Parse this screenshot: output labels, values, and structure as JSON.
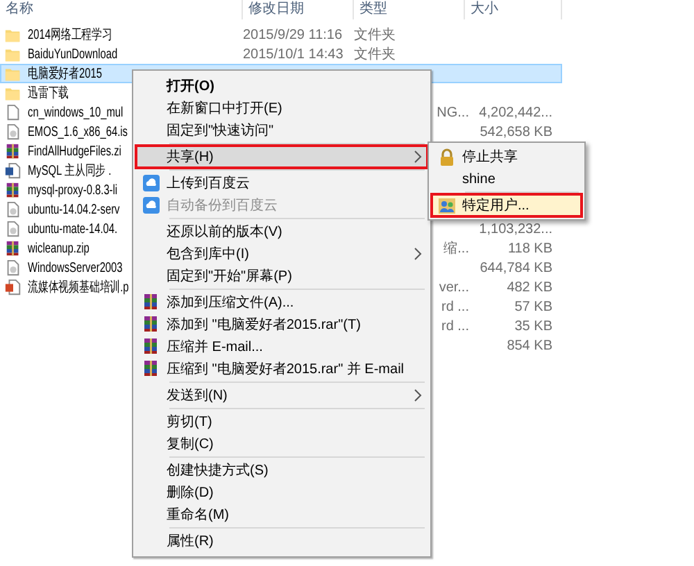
{
  "columns": [
    {
      "label": "名称"
    },
    {
      "label": "修改日期"
    },
    {
      "label": "类型"
    },
    {
      "label": "大小"
    }
  ],
  "files": [
    {
      "name": "2014网络工程学习",
      "kind": "folder",
      "date": "2015/9/29 11:16",
      "type": "文件夹",
      "selected": false
    },
    {
      "name": "BaiduYunDownload",
      "kind": "folder",
      "date": "2015/10/1 14:43",
      "type": "文件夹",
      "selected": false
    },
    {
      "name": "电脑爱好者2015",
      "kind": "folder",
      "selected": true
    },
    {
      "name": "迅雷下载",
      "kind": "folder",
      "selected": false
    },
    {
      "name": "cn_windows_10_mul",
      "kind": "file",
      "type": "NG...",
      "size": "4,202,442...",
      "selected": false
    },
    {
      "name": "EMOS_1.6_x86_64.is",
      "kind": "disc",
      "size": "542,658 KB",
      "selected": false
    },
    {
      "name": "FindAllHudgeFiles.zi",
      "kind": "archive",
      "selected": false
    },
    {
      "name": "MySQL 主从同步 .",
      "kind": "doc",
      "selected": false
    },
    {
      "name": "mysql-proxy-0.8.3-li",
      "kind": "archive",
      "selected": false
    },
    {
      "name": "ubuntu-14.04.2-serv",
      "kind": "disc",
      "selected": false
    },
    {
      "name": "ubuntu-mate-14.04.",
      "kind": "disc",
      "size": "1,103,232...",
      "selected": false
    },
    {
      "name": "wicleanup.zip",
      "kind": "archive",
      "type": "缩...",
      "size": "118 KB",
      "selected": false
    },
    {
      "name": "WindowsServer2003",
      "kind": "disc",
      "size": "644,784 KB",
      "selected": false
    },
    {
      "name": "流媒体视频基础培训.p",
      "kind": "ppt",
      "type": "ver...",
      "size": "482 KB",
      "selected": false
    },
    {
      "type": "rd ...",
      "size": "57 KB",
      "selected": false
    },
    {
      "type": "rd ...",
      "size": "35 KB",
      "selected": false
    },
    {
      "size": "854 KB",
      "selected": false
    }
  ],
  "context_menu": [
    {
      "kind": "item",
      "label": "打开(O)",
      "bold": true,
      "selected": false
    },
    {
      "kind": "item",
      "label": "在新窗口中打开(E)",
      "selected": false
    },
    {
      "kind": "item",
      "label": "固定到\"快速访问\"",
      "selected": false
    },
    {
      "kind": "separator"
    },
    {
      "kind": "item",
      "label": "共享(H)",
      "submenu": true,
      "selected": true,
      "highlighted": true
    },
    {
      "kind": "separator"
    },
    {
      "kind": "cloud",
      "label": "上传到百度云",
      "selected": false
    },
    {
      "kind": "cloud",
      "label": "自动备份到百度云",
      "disabled": true,
      "selected": false
    },
    {
      "kind": "separator"
    },
    {
      "kind": "item",
      "label": "还原以前的版本(V)",
      "selected": false
    },
    {
      "kind": "item",
      "label": "包含到库中(I)",
      "submenu": true,
      "selected": false
    },
    {
      "kind": "item",
      "label": "固定到\"开始\"屏幕(P)",
      "selected": false
    },
    {
      "kind": "separator"
    },
    {
      "kind": "archive",
      "label": "添加到压缩文件(A)...",
      "selected": false
    },
    {
      "kind": "archive",
      "label": "添加到 \"电脑爱好者2015.rar\"(T)",
      "selected": false
    },
    {
      "kind": "archive",
      "label": "压缩并 E-mail...",
      "selected": false
    },
    {
      "kind": "archive",
      "label": "压缩到 \"电脑爱好者2015.rar\" 并 E-mail",
      "selected": false
    },
    {
      "kind": "separator"
    },
    {
      "kind": "item",
      "label": "发送到(N)",
      "submenu": true,
      "selected": false
    },
    {
      "kind": "separator"
    },
    {
      "kind": "item",
      "label": "剪切(T)",
      "selected": false
    },
    {
      "kind": "item",
      "label": "复制(C)",
      "selected": false
    },
    {
      "kind": "separator"
    },
    {
      "kind": "item",
      "label": "创建快捷方式(S)",
      "selected": false
    },
    {
      "kind": "item",
      "label": "删除(D)",
      "selected": false
    },
    {
      "kind": "item",
      "label": "重命名(M)",
      "selected": false
    },
    {
      "kind": "separator"
    },
    {
      "kind": "item",
      "label": "属性(R)",
      "selected": false
    }
  ],
  "share_submenu": [
    {
      "kind": "lock",
      "label": "停止共享",
      "selected": false
    },
    {
      "kind": "item",
      "label": "shine",
      "selected": false
    },
    {
      "kind": "separator"
    },
    {
      "kind": "users",
      "label": "特定用户...",
      "selected": false,
      "highlighted": true
    }
  ]
}
